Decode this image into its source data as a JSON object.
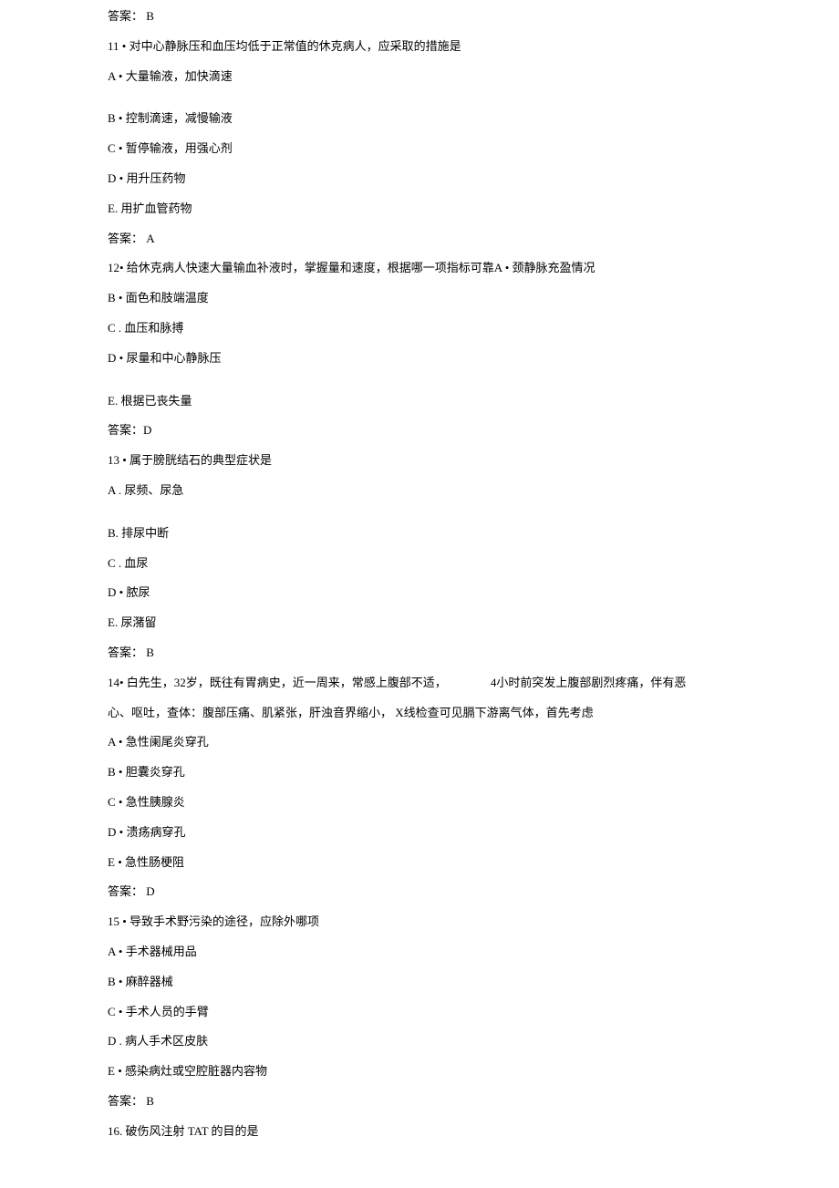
{
  "lines": [
    {
      "text": "答案：  B"
    },
    {
      "text": "11  • 对中心静脉压和血压均低于正常值的休克病人，应采取的措施是"
    },
    {
      "text": "A • 大量输液，加快滴速",
      "spacedAfter": true
    },
    {
      "text": "B • 控制滴速，减慢输液"
    },
    {
      "text": "C • 暂停输液，用强心剂"
    },
    {
      "text": "D • 用升压药物"
    },
    {
      "text": "E.   用扩血管药物"
    },
    {
      "text": "答案：  A"
    },
    {
      "text": "12• 给休克病人快速大量输血补液时，掌握量和速度，根据哪一项指标可靠A • 颈静脉充盈情况"
    },
    {
      "text": "B • 面色和肢端温度"
    },
    {
      "text": "C . 血压和脉搏"
    },
    {
      "text": "D • 尿量和中心静脉压",
      "spacedAfter": true
    },
    {
      "text": "E. 根据已丧失量"
    },
    {
      "text": "答案：D"
    },
    {
      "text": "13 • 属于膀胱结石的典型症状是"
    },
    {
      "text": "A . 尿频、尿急",
      "spacedAfter": true
    },
    {
      "text": "B. 排尿中断"
    },
    {
      "text": "C . 血尿"
    },
    {
      "text": "D • 脓尿"
    },
    {
      "text": "E. 尿潴留"
    },
    {
      "text": "答案：  B"
    },
    {
      "html": "14• 白先生，32岁，既往有胃病史，近一周来，常感上腹部不适，<span class=\"indent-gap\"></span>4小时前突发上腹部剧烈疼痛，伴有恶"
    },
    {
      "text": "心、呕吐，查体：腹部压痛、肌紧张，肝浊音界缩小，  X线检查可见膈下游离气体，首先考虑"
    },
    {
      "text": "A • 急性阑尾炎穿孔"
    },
    {
      "text": "B • 胆囊炎穿孔"
    },
    {
      "text": "C • 急性胰腺炎"
    },
    {
      "text": "D • 溃疡病穿孔"
    },
    {
      "text": "E •  急性肠梗阻"
    },
    {
      "text": "答案：  D"
    },
    {
      "text": "15 • 导致手术野污染的途径，应除外哪项"
    },
    {
      "text": "A • 手术器械用品"
    },
    {
      "text": "B • 麻醉器械"
    },
    {
      "text": "C • 手术人员的手臂"
    },
    {
      "text": "D . 病人手术区皮肤"
    },
    {
      "text": "E •  感染病灶或空腔脏器内容物"
    },
    {
      "text": "答案：  B"
    },
    {
      "text": "16.  破伤风注射  TAT 的目的是"
    }
  ]
}
